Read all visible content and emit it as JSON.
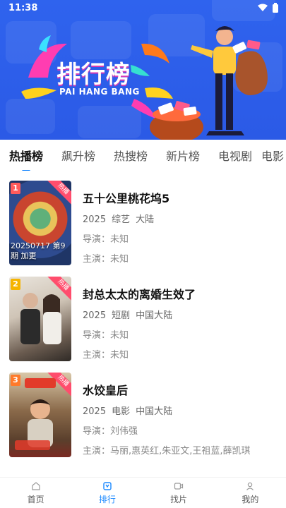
{
  "status": {
    "time": "11:38"
  },
  "banner": {
    "title": "排行榜",
    "subtitle": "PAI HANG BANG"
  },
  "tabs": [
    {
      "label": "热播榜",
      "active": true
    },
    {
      "label": "飙升榜"
    },
    {
      "label": "热搜榜"
    },
    {
      "label": "新片榜"
    },
    {
      "label": "电视剧"
    },
    {
      "label": "电影"
    }
  ],
  "items": [
    {
      "rank": "1",
      "rank_color": "#ff5b5b",
      "badge": "热播",
      "poster_caption": "20250717 第9期 加更",
      "title": "五十公里桃花坞5",
      "year": "2025",
      "genre": "综艺",
      "region": "大陆",
      "director_label": "导演：",
      "director": "未知",
      "cast_label": "主演：",
      "cast": "未知"
    },
    {
      "rank": "2",
      "rank_color": "#f5b400",
      "badge": "热播",
      "poster_caption": "",
      "title": "封总太太的离婚生效了",
      "year": "2025",
      "genre": "短剧",
      "region": "中国大陆",
      "director_label": "导演：",
      "director": "未知",
      "cast_label": "主演：",
      "cast": "未知"
    },
    {
      "rank": "3",
      "rank_color": "#ff7a2a",
      "badge": "热播",
      "poster_caption": "",
      "title": "水饺皇后",
      "year": "2025",
      "genre": "电影",
      "region": "中国大陆",
      "director_label": "导演：",
      "director": "刘伟强",
      "cast_label": "主演：",
      "cast": "马丽,惠英红,朱亚文,王祖蓝,薛凯琪"
    }
  ],
  "nav": [
    {
      "label": "首页",
      "icon": "home-icon"
    },
    {
      "label": "排行",
      "icon": "ranking-icon",
      "active": true
    },
    {
      "label": "找片",
      "icon": "video-icon"
    },
    {
      "label": "我的",
      "icon": "user-icon"
    }
  ],
  "colors": {
    "accent": "#1a88ff",
    "banner": "#2f63ee"
  }
}
